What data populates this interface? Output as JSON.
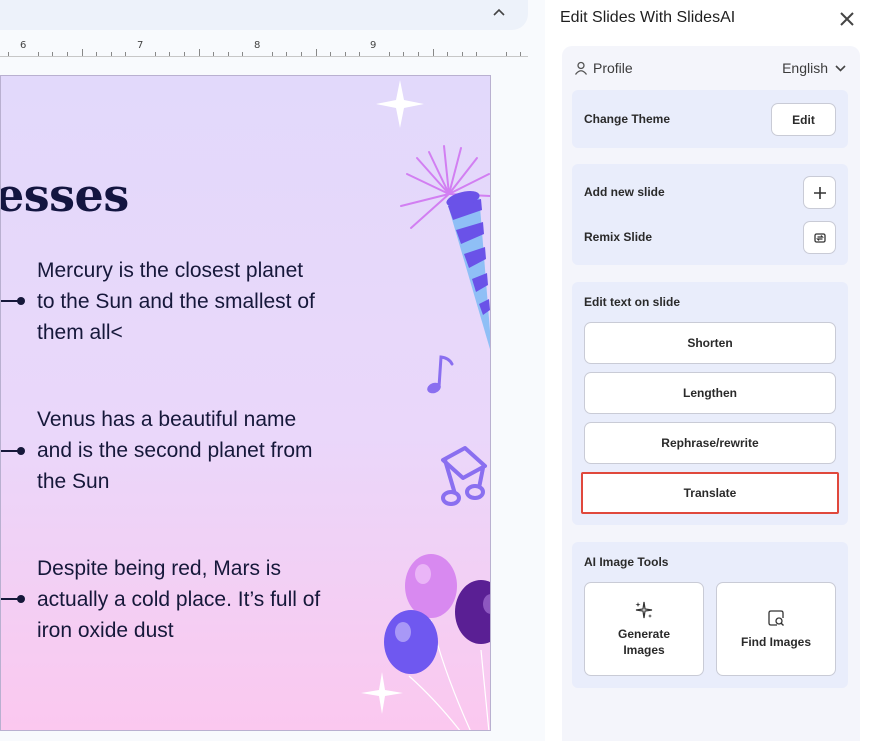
{
  "ruler": {
    "numbers": [
      "6",
      "7",
      "8",
      "9"
    ]
  },
  "slide": {
    "title": "esses",
    "bullets": [
      "Mercury is the closest planet to the Sun and the smallest of them all<",
      "Venus has a beautiful name and is the second planet from the Sun",
      "Despite being red, Mars is actually a cold place. It’s full of iron oxide dust"
    ]
  },
  "panel": {
    "title": "Edit Slides With SlidesAI",
    "profile_label": "Profile",
    "language": "English",
    "theme": {
      "label": "Change Theme",
      "edit_button": "Edit"
    },
    "slides": {
      "add_label": "Add new slide",
      "remix_label": "Remix Slide"
    },
    "edit_text": {
      "label": "Edit text on slide",
      "buttons": [
        "Shorten",
        "Lengthen",
        "Rephrase/rewrite",
        "Translate"
      ]
    },
    "image_tools": {
      "label": "AI Image Tools",
      "generate": "Generate Images",
      "find": "Find Images"
    }
  },
  "colors": {
    "accent_highlight": "#e0483c",
    "slide_text": "#16183a",
    "card_bg": "#e9edfb",
    "panel_inner_bg": "#f4f5fb"
  },
  "icons": [
    "chevron-up-icon",
    "close-icon",
    "person-icon",
    "chevron-down-icon",
    "plus-icon",
    "remix-icon",
    "sparkles-icon",
    "image-search-icon"
  ]
}
